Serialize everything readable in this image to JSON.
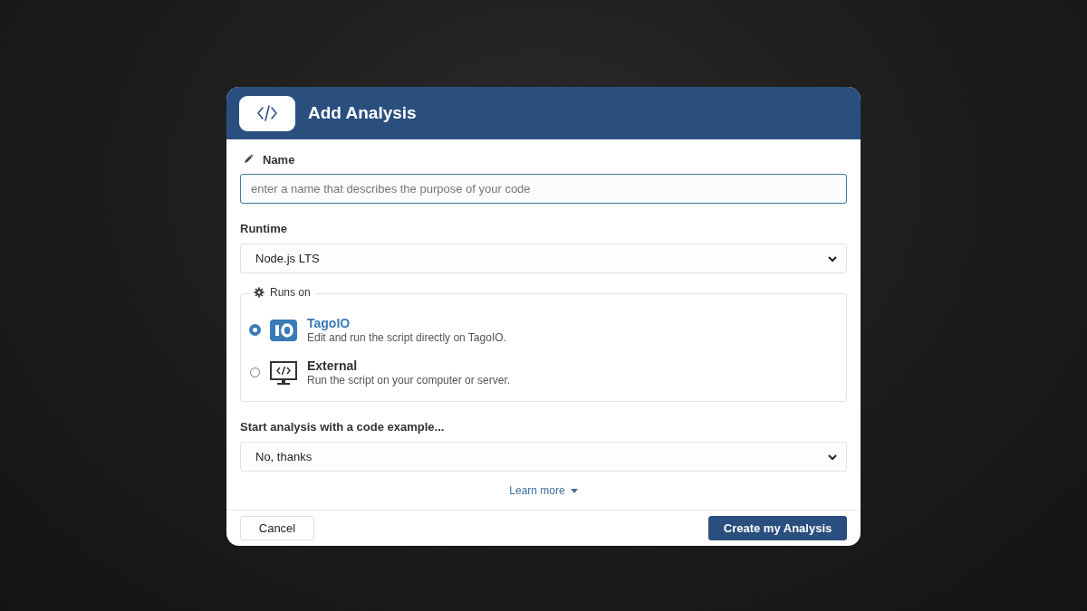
{
  "dialog": {
    "title": "Add Analysis"
  },
  "name_field": {
    "label": "Name",
    "placeholder": "enter a name that describes the purpose of your code"
  },
  "runtime": {
    "label": "Runtime",
    "value": "Node.js LTS"
  },
  "runs_on": {
    "legend": "Runs on",
    "options": [
      {
        "kind": "tagoio",
        "title": "TagoIO",
        "description": "Edit and run the script directly on TagoIO.",
        "selected": true
      },
      {
        "kind": "external",
        "title": "External",
        "description": "Run the script on your computer or server.",
        "selected": false
      }
    ]
  },
  "code_example": {
    "label": "Start analysis with a code example...",
    "value": "No, thanks"
  },
  "learn_more": "Learn more",
  "buttons": {
    "cancel": "Cancel",
    "create": "Create my Analysis"
  }
}
